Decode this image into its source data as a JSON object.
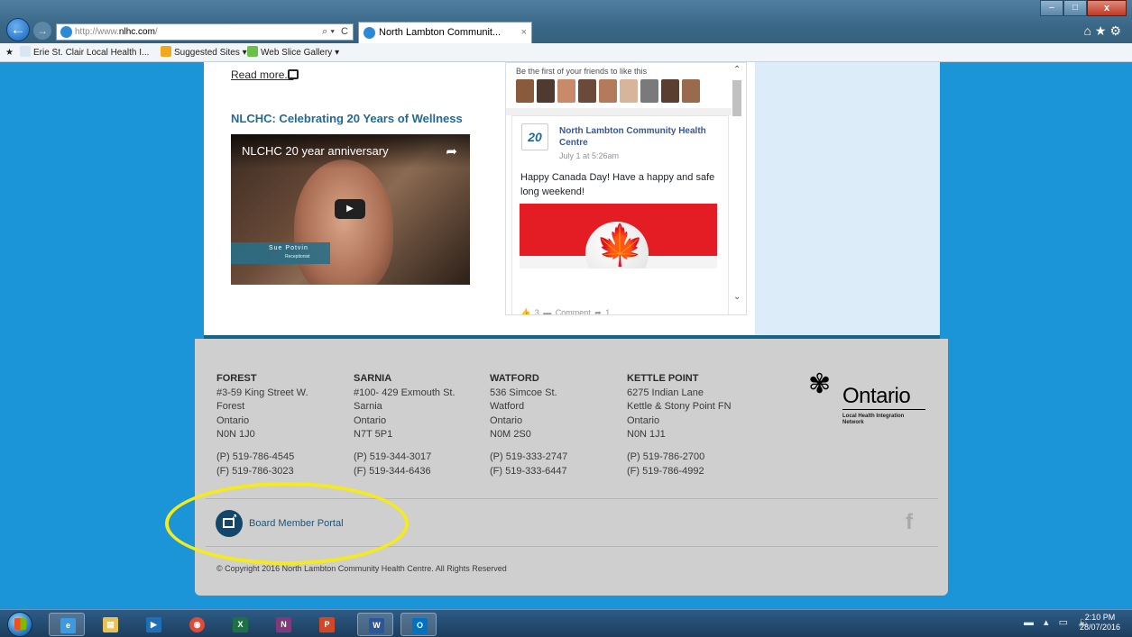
{
  "browser": {
    "url_prefix": "http://www.",
    "url_host": "nlhc.com",
    "url_suffix": "/",
    "tab_title": "North Lambton Communit...",
    "tab_close": "×",
    "back_glyph": "←",
    "forward_glyph": "→",
    "search_glyph": "⌕ ▾",
    "refresh_glyph": "C",
    "right_icons": "⌂★⚙",
    "window": {
      "minimize": "–",
      "maximize": "□",
      "close": "x"
    }
  },
  "favorites": {
    "items": [
      {
        "label": "Erie St. Clair Local Health I...",
        "icon": "page-icon"
      },
      {
        "label": "Suggested Sites ▾",
        "icon": "bing-icon"
      },
      {
        "label": "Web Slice Gallery ▾",
        "icon": "web-slice-icon"
      }
    ]
  },
  "page": {
    "read_more": "Read more...",
    "video_heading": "NLCHC: Celebrating 20 Years of Wellness",
    "video": {
      "title": "NLCHC 20 year anniversary",
      "person_name": "Sue Potvin",
      "person_role": "Receptionist",
      "play_glyph": "▶",
      "share_glyph": "➦"
    },
    "facebook": {
      "friends_text": "Be the first of your friends to like this",
      "logo_text": "20",
      "page_name": "North Lambton Community Health Centre",
      "timestamp": "July 1 at 5:26am",
      "post_text": "Happy Canada Day! Have a happy and safe long weekend!",
      "leaf_glyph": "🍁",
      "actions": "👍 3    ▬ Comment    ➦ 1",
      "scroll_up": "⌃",
      "scroll_down": "⌄"
    }
  },
  "footer": {
    "locations": [
      {
        "name": "FOREST",
        "address1": "#3-59 King Street W.",
        "city": "Forest",
        "province": "Ontario",
        "postal": "N0N 1J0",
        "phone": "(P) 519-786-4545",
        "fax": "(F) 519-786-3023"
      },
      {
        "name": "SARNIA",
        "address1": "#100- 429 Exmouth St.",
        "city": "Sarnia",
        "province": "Ontario",
        "postal": "N7T 5P1",
        "phone": "(P) 519-344-3017",
        "fax": "(F) 519-344-6436"
      },
      {
        "name": "WATFORD",
        "address1": "536 Simcoe St.",
        "city": "Watford",
        "province": "Ontario",
        "postal": "N0M 2S0",
        "phone": "(P) 519-333-2747",
        "fax": "(F) 519-333-6447"
      },
      {
        "name": "KETTLE POINT",
        "address1": "6275 Indian Lane",
        "city": "Kettle & Stony Point FN",
        "province": "Ontario",
        "postal": "N0N 1J1",
        "phone": "(P) 519-786-2700",
        "fax": "(F) 519-786-4992"
      }
    ],
    "ontario": {
      "trillium_glyph": "✾",
      "word": "Ontario",
      "network_line1": "Local Health Integration",
      "network_line2": "Network"
    },
    "portal_link": "Board Member Portal",
    "facebook_glyph": "f",
    "copyright": "© Copyright 2016 North Lambton Community Health Centre. All Rights Reserved"
  },
  "taskbar": {
    "apps": [
      {
        "name": "ie",
        "label": "e",
        "color": "#3b9ae1"
      },
      {
        "name": "explorer",
        "label": "▤",
        "color": "#e8c257"
      },
      {
        "name": "media",
        "label": "▶",
        "color": "#1f6fb5"
      },
      {
        "name": "chrome",
        "label": "◉",
        "color": "#dd4b39"
      },
      {
        "name": "excel",
        "label": "X",
        "color": "#1e7145"
      },
      {
        "name": "onenote",
        "label": "N",
        "color": "#80397b"
      },
      {
        "name": "powerpoint",
        "label": "P",
        "color": "#d24726"
      },
      {
        "name": "word",
        "label": "W",
        "color": "#2b579a"
      },
      {
        "name": "outlook",
        "label": "O",
        "color": "#0072c6"
      }
    ],
    "tray": "▬ ▴ ▭ 🔈",
    "time": "2:10 PM",
    "date": "28/07/2016"
  }
}
